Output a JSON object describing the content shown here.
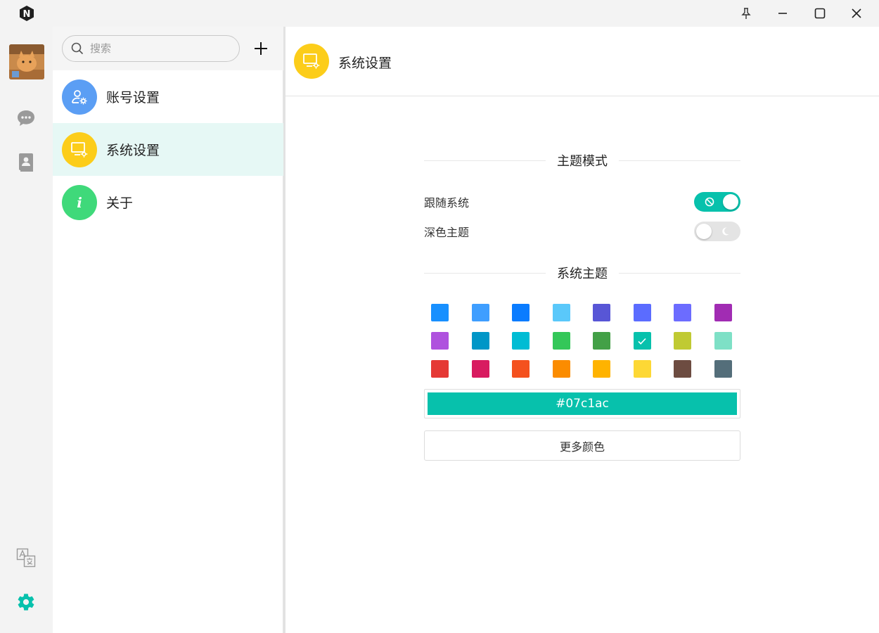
{
  "window": {
    "logo_letter": "N",
    "controls": [
      "pin-icon",
      "minimize-icon",
      "maximize-icon",
      "close-icon"
    ]
  },
  "rail": {
    "items": [
      "chat-icon",
      "contacts-icon"
    ],
    "bottom": [
      "translate-icon",
      "settings-gear-icon"
    ],
    "accent": "#07c1ac"
  },
  "list": {
    "search_placeholder": "搜索",
    "items": [
      {
        "label": "账号设置",
        "color": "#5b9ef4",
        "icon": "account-settings-icon"
      },
      {
        "label": "系统设置",
        "color": "#fccd1a",
        "icon": "system-settings-icon",
        "active": true
      },
      {
        "label": "关于",
        "color": "#3fd97a",
        "icon": "info-icon"
      }
    ]
  },
  "main": {
    "title": "系统设置",
    "theme_mode": {
      "heading": "主题模式",
      "follow_system_label": "跟随系统",
      "follow_system_on": true,
      "dark_theme_label": "深色主题",
      "dark_theme_on": false
    },
    "system_theme": {
      "heading": "系统主题",
      "colors": [
        "#1890ff",
        "#3f9eff",
        "#0a7cff",
        "#5ac8fa",
        "#5856d6",
        "#5b6cff",
        "#6c6cff",
        "#a12cb3",
        "#af52de",
        "#0096c7",
        "#00bcd4",
        "#34c759",
        "#43a047",
        "#07c1ac",
        "#c0ca33",
        "#7ee0c6",
        "#e53935",
        "#d81b60",
        "#f4511e",
        "#fb8c00",
        "#ffb300",
        "#fdd835",
        "#6d4c41",
        "#546e7a"
      ],
      "selected_index": 13,
      "current_hex": "#07c1ac",
      "more_colors_label": "更多颜色"
    }
  }
}
